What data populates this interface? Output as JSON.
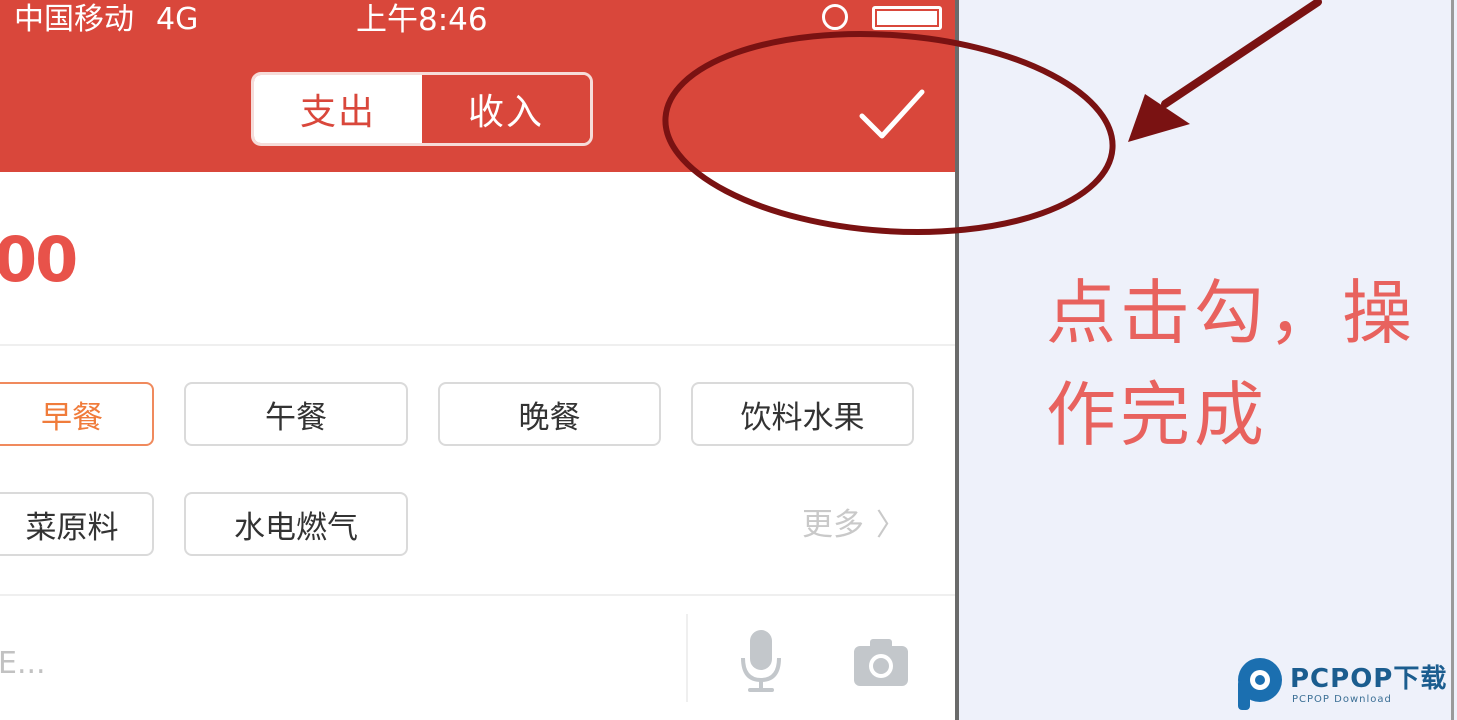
{
  "status_bar": {
    "carrier": "中国移动",
    "network": "4G",
    "time": "上午8:46"
  },
  "header": {
    "tabs": [
      {
        "label": "支出",
        "active": true
      },
      {
        "label": "收入",
        "active": false
      }
    ],
    "confirm_icon": "checkmark-icon"
  },
  "amount": "00",
  "categories": {
    "row1": [
      "早餐",
      "午餐",
      "晚餐",
      "饮料水果"
    ],
    "row2": [
      "菜原料",
      "水电燃气"
    ],
    "selected": "早餐",
    "more_label": "更多"
  },
  "note": {
    "placeholder": "E..."
  },
  "annotation": {
    "line1": "点击勾，操",
    "line2": "作完成"
  },
  "watermark": {
    "brand": "PCPOP下载",
    "sub": "PCPOP Download"
  },
  "colors": {
    "header_red": "#d9473b",
    "amount_red": "#e8524a",
    "selected_orange": "#f07c3b",
    "annotation_dark_red": "#7a1212",
    "annotation_text": "#e8625e",
    "panel_bg": "#eef1fa"
  }
}
